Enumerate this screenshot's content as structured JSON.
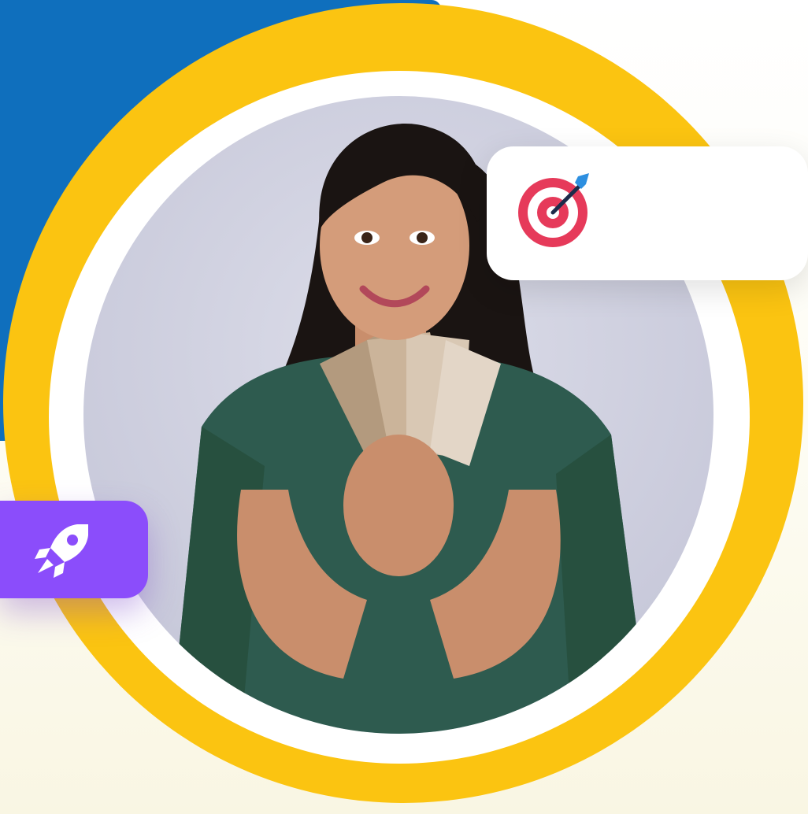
{
  "colors": {
    "blue_accent": "#0f6fbd",
    "yellow_accent": "#fbc411",
    "purple_accent": "#8b4dfb",
    "card_white": "#ffffff"
  },
  "hero": {
    "photo_subject": "person-holding-banknotes"
  },
  "badges": [
    {
      "name": "target-badge",
      "icon": "target-dart-icon"
    },
    {
      "name": "rocket-badge",
      "icon": "rocket-icon"
    }
  ]
}
